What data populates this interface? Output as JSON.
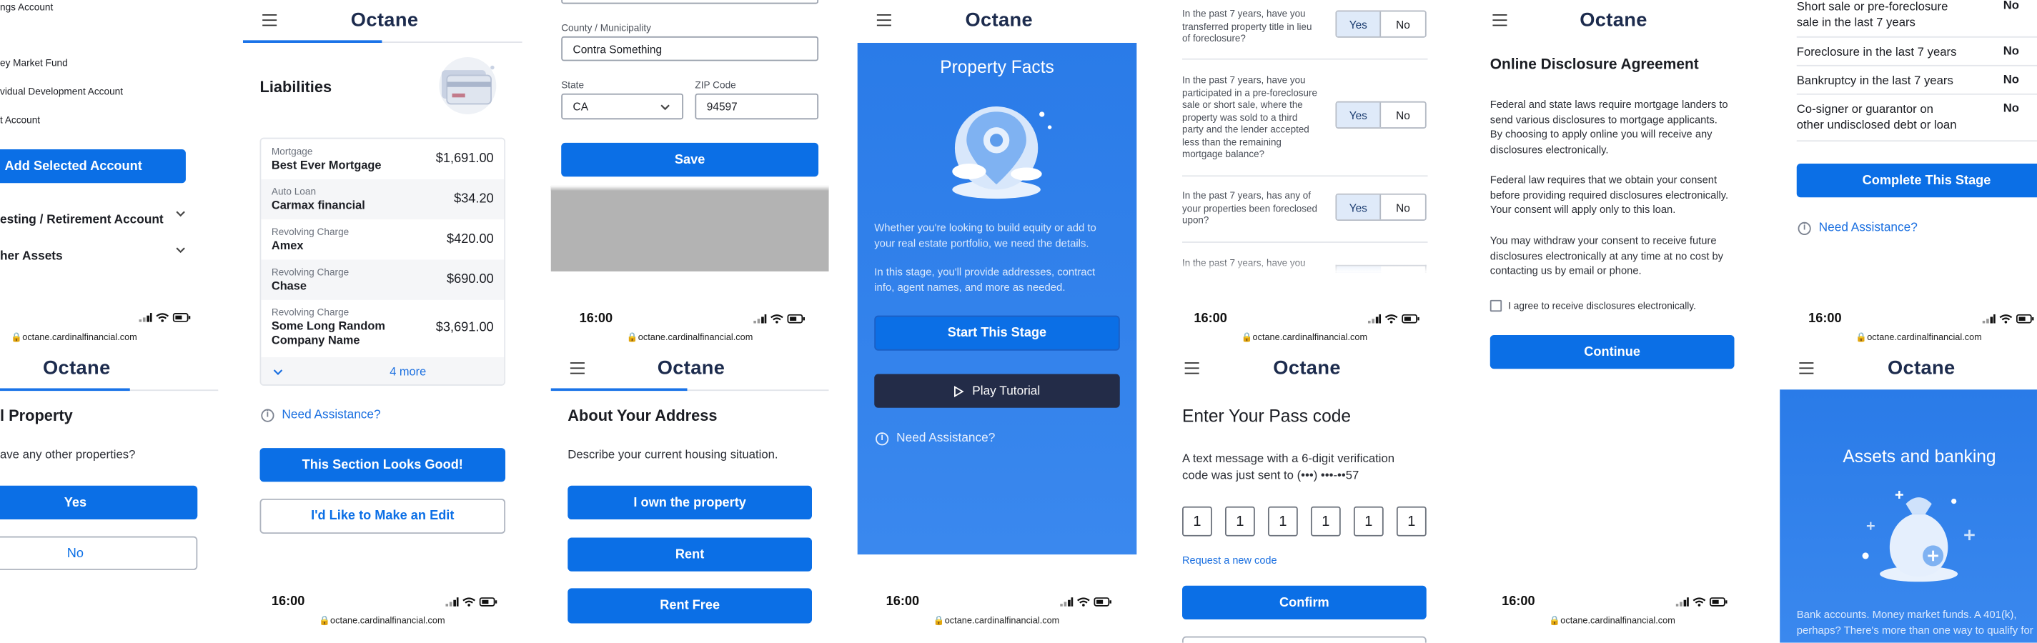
{
  "app": {
    "logo": "Octane",
    "url": "octane.cardinalfinancial.com",
    "time": "16:00"
  },
  "colors": {
    "primary": "#0b6fe6",
    "blue_bg": "#2f80ec",
    "dark_btn": "#232c48"
  },
  "p1": {
    "accounts": [
      "ngs Account",
      "ey Market Fund",
      "vidual Development Account",
      "t Account"
    ],
    "add_button": "Add Selected Account",
    "sections": [
      "esting / Retirement Account",
      "her Assets"
    ],
    "title": "l Property",
    "question": "ave any other properties?",
    "yes": "Yes",
    "no": "No"
  },
  "p2": {
    "title": "Liabilities",
    "rows": [
      {
        "category": "Mortgage",
        "name": "Best Ever Mortgage",
        "amount": "$1,691.00"
      },
      {
        "category": "Auto Loan",
        "name": "Carmax financial",
        "amount": "$34.20"
      },
      {
        "category": "Revolving Charge",
        "name": "Amex",
        "amount": "$420.00"
      },
      {
        "category": "Revolving Charge",
        "name": "Chase",
        "amount": "$690.00"
      },
      {
        "category": "Revolving Charge",
        "name": "Some Long Random Company Name",
        "name_l1": "Some Long Random",
        "name_l2": "Company Name",
        "amount": "$3,691.00"
      }
    ],
    "more": "4 more",
    "need_help": "Need Assistance?",
    "looks_good": "This Section Looks Good!",
    "edit": "I'd Like to Make an Edit"
  },
  "p3": {
    "county_label": "County / Municipality",
    "county_value": "Contra Something",
    "state_label": "State",
    "state_value": "CA",
    "zip_label": "ZIP Code",
    "zip_value": "94597",
    "save": "Save",
    "title": "About Your Address",
    "question": "Describe your current housing situation.",
    "options": [
      "I own the property",
      "Rent",
      "Rent Free"
    ]
  },
  "p4": {
    "title": "Property Facts",
    "para1": "Whether you're looking to build equity or add to your real estate portfolio, we need the details.",
    "para1_l1": "Whether you're looking to build equity or add to",
    "para1_l2": "your real estate portfolio, we need the details.",
    "para2_l1": "In this stage, you'll provide addresses, contract",
    "para2_l2": "info, agent names, and more as needed.",
    "start": "Start This Stage",
    "tutorial": "Play Tutorial",
    "need_help": "Need Assistance?"
  },
  "p5": {
    "questions": [
      {
        "lines": [
          "In the past 7 years, have you",
          "transferred property title in lieu",
          "of foreclosure?"
        ]
      },
      {
        "lines": [
          "In the past 7 years, have you",
          "participated in a pre-foreclosure",
          "sale or short sale, where the",
          "property was sold to a third",
          "party and the lender accepted",
          "less than the remaining",
          "mortgage balance?"
        ]
      },
      {
        "lines": [
          "In the past 7 years, has any of",
          "your properties been foreclosed",
          "upon?"
        ]
      },
      {
        "lines": [
          "In the past 7 years, have you"
        ]
      }
    ],
    "yes": "Yes",
    "no": "No",
    "title": "Enter Your Pass code",
    "desc_l1": "A text message with a 6-digit verification",
    "desc_l2": "code was just sent to (•••) •••-••57",
    "digits": [
      "1",
      "1",
      "1",
      "1",
      "1",
      "1"
    ],
    "request": "Request a new code",
    "confirm": "Confirm"
  },
  "p6": {
    "title": "Online Disclosure Agreement",
    "paras": [
      [
        "Federal and state laws require mortgage landers to",
        "send various disclosures to mortgage applicants.",
        "By choosing to apply online you will receive any",
        "disclosures electronically."
      ],
      [
        "Federal law requires that we obtain your consent",
        "before providing required disclosures electronically.",
        "Your consent will apply only to this loan."
      ],
      [
        "You may withdraw your consent to receive future",
        "disclosures electronically at any time at no cost by",
        "contacting us by email or phone."
      ]
    ],
    "agree": "I agree to receive disclosures electronically.",
    "continue": "Continue"
  },
  "p7": {
    "summary": [
      {
        "l1": "Short sale or pre-foreclosure",
        "l2": "sale in the last 7 years",
        "value": "No"
      },
      {
        "l1": "Foreclosure in the last 7 years",
        "l2": "",
        "value": "No"
      },
      {
        "l1": "Bankruptcy in the last 7 years",
        "l2": "",
        "value": "No"
      },
      {
        "l1": "Co-signer or guarantor on",
        "l2": "other undisclosed debt or loan",
        "value": "No"
      }
    ],
    "complete": "Complete This Stage",
    "need_help": "Need Assistance?",
    "title": "Assets and banking",
    "para_l1": "Bank accounts. Money market funds. A 401(k),",
    "para_l2": "perhaps? There's more than one way to qualify for"
  }
}
